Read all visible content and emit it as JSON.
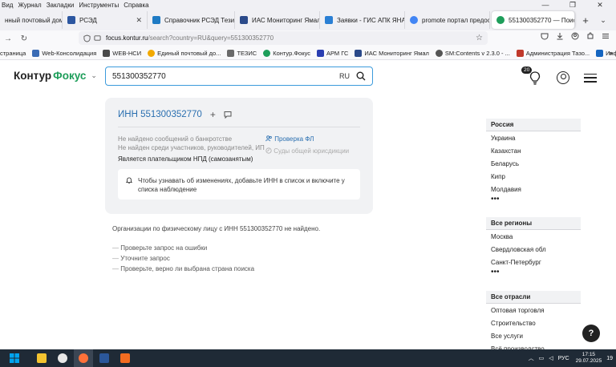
{
  "menu": [
    "Вид",
    "Журнал",
    "Закладки",
    "Инструменты",
    "Справка"
  ],
  "window_controls": [
    "—",
    "❐",
    "✕"
  ],
  "tabs": [
    {
      "label": "нный почтовый домен",
      "color": "#ffffff",
      "icon": "tab-favicon"
    },
    {
      "label": "РСЭД",
      "color": "#2c56a0",
      "icon": "rsed-icon"
    },
    {
      "label": "Справочник РСЭД Тезис",
      "color": "#1f7bc4",
      "icon": "tezis-icon"
    },
    {
      "label": "ИАС Мониторинг Ямал",
      "color": "#2b4a8a",
      "icon": "ias-icon"
    },
    {
      "label": "Заявки - ГИС АПК ЯНАО",
      "color": "#2a7fd4",
      "icon": "gis-apk-icon"
    },
    {
      "label": "promote портал предоста",
      "color": "#4285f4",
      "icon": "google-icon"
    },
    {
      "label": "551300352770 — Поиск",
      "color": "#1e9e5a",
      "icon": "kontur-icon",
      "active": true
    }
  ],
  "tab_close": "✕",
  "tab_new": "+",
  "tab_list": "⌄",
  "nav": {
    "back": "→",
    "reload": "↻",
    "url_host": "focus.kontur.ru",
    "url_path": "/search?country=RU&query=551300352770",
    "star": "☆",
    "right_icons": [
      "pocket-icon",
      "download-icon",
      "account-icon",
      "extensions-icon",
      "menu-icon"
    ]
  },
  "bookmarks": [
    {
      "label": "страница",
      "color": ""
    },
    {
      "label": "Web-Консолидация",
      "color": "#3a6bb5"
    },
    {
      "label": "WEB-НСИ",
      "color": "#4a4a4a"
    },
    {
      "label": "Единый почтовый до...",
      "color": "#f2a900"
    },
    {
      "label": "ТЕЗИС",
      "color": "#6a6a6a"
    },
    {
      "label": "Контур.Фокус",
      "color": "#1e9e5a"
    },
    {
      "label": "АРМ ГС",
      "color": "#2a3eb1"
    },
    {
      "label": "ИАС Мониторинг Ямал",
      "color": "#2b4a8a"
    },
    {
      "label": "SM:Contents v 2.3.0 - ...",
      "color": "#555555"
    },
    {
      "label": "Администрация Тазо...",
      "color": "#c0392b"
    },
    {
      "label": "Информационный м...",
      "color": "#1565c0"
    }
  ],
  "bookmarks_more": "»",
  "logo": {
    "part1": "Контур",
    "part2": "Фокус",
    "chevron": "⌄"
  },
  "search": {
    "value": "551300352770",
    "country": "RU"
  },
  "notifications_count": "20",
  "card": {
    "inn": "ИНН 551300352770",
    "plus": "+",
    "info_lines": [
      "Не найдено сообщений о банкротстве",
      "Не найден среди участников, руководителей, ИП"
    ],
    "status": "Является плательщиком НПД (самозанятым)",
    "link_check": "Проверка ФЛ",
    "link_courts": "Суды общей юрисдикции",
    "notice": "Чтобы узнавать об изменениях, добавьте ИНН в список и включите у списка наблюдение"
  },
  "notfound": "Организации по физическому лицу с ИНН 551300352770 не найдено.",
  "tips": [
    "Проверьте запрос на ошибки",
    "Уточните запрос",
    "Проверьте, верно ли выбрана страна поиска"
  ],
  "filters": {
    "countries": {
      "head": "Россия",
      "items": [
        "Украина",
        "Казахстан",
        "Беларусь",
        "Кипр",
        "Молдавия"
      ],
      "more": "•••"
    },
    "regions": {
      "head": "Все регионы",
      "items": [
        "Москва",
        "Свердловская обл",
        "Санкт-Петербург"
      ],
      "more": "•••"
    },
    "industries": {
      "head": "Все отрасли",
      "items": [
        "Оптовая торговля",
        "Строительство",
        "Все услуги",
        "Всё производство"
      ]
    }
  },
  "help": "?",
  "taskbar": {
    "apps": [
      {
        "name": "windows-start-icon",
        "color": "#00a4ef"
      },
      {
        "name": "file-explorer-icon",
        "color": "#f4c430"
      },
      {
        "name": "yandex-browser-icon",
        "color": "#e8e8e8"
      },
      {
        "name": "firefox-icon",
        "color": "#ff7139"
      },
      {
        "name": "word-icon",
        "color": "#2b579a"
      },
      {
        "name": "xmind-icon",
        "color": "#f36c21"
      }
    ],
    "lang": "РУС",
    "time": "17:15",
    "date": "29.07.2025",
    "badge": "19"
  }
}
